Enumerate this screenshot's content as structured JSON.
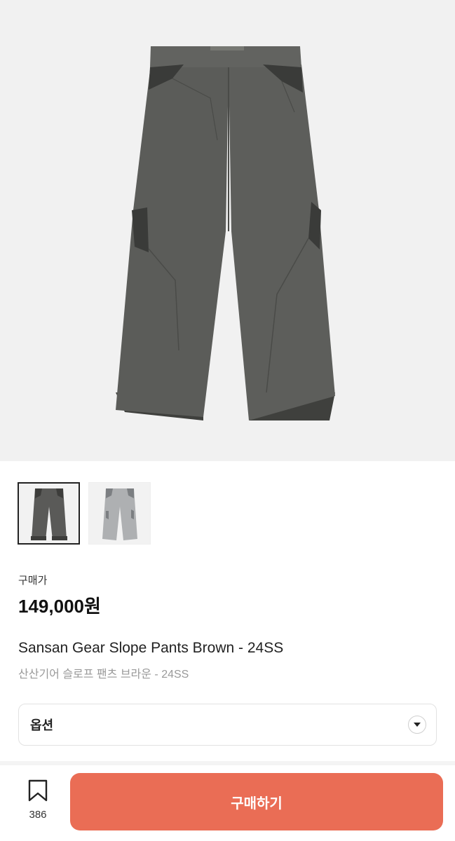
{
  "product": {
    "price_label": "구매가",
    "price": "149,000원",
    "title_en": "Sansan Gear Slope Pants Brown - 24SS",
    "title_ko": "산산기어 슬로프 팬츠 브라운 - 24SS"
  },
  "gallery": {
    "images": [
      {
        "name": "pants-charcoal",
        "color": "#5a5a58",
        "accent": "#3d3d3b"
      },
      {
        "name": "pants-light-grey",
        "color": "#a9abad",
        "accent": "#7c7f82"
      }
    ],
    "selected_index": 0
  },
  "options": {
    "label": "옵션",
    "icon": "chevron-down-icon"
  },
  "bottom_bar": {
    "bookmark_icon": "bookmark-icon",
    "bookmark_count": "386",
    "buy_label": "구매하기",
    "buy_color": "#ea6d55"
  }
}
